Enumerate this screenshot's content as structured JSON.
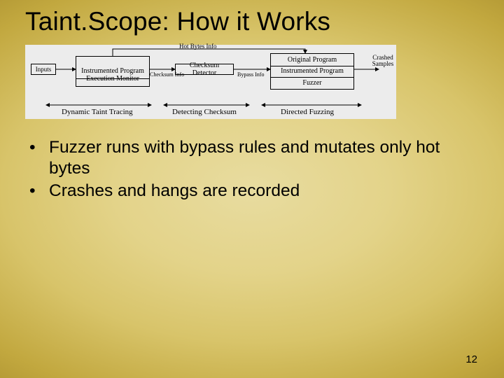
{
  "title": "Taint.Scope: How it Works",
  "diagram": {
    "nodes": {
      "inputs": "Inputs",
      "instrumented_program": "Instrumented Program",
      "execution_monitor": "Execution Monitor",
      "checksum_detector": "Checksum Detector",
      "original_program": "Original Program",
      "instrumented_program2": "Instrumented Program",
      "fuzzer": "Fuzzer"
    },
    "edge_labels": {
      "hot_bytes_info": "Hot Bytes Info",
      "checksum_info": "Checksum Info",
      "bypass_info": "Bypass Info",
      "crashed_samples": "Crashed Samples"
    },
    "phases": {
      "dynamic_taint": "Dynamic Taint Tracing",
      "detecting_checksum": "Detecting Checksum",
      "directed_fuzzing": "Directed Fuzzing"
    }
  },
  "bullets": [
    "Fuzzer runs with bypass rules and mutates only hot bytes",
    "Crashes and hangs are recorded"
  ],
  "page_number": "12"
}
